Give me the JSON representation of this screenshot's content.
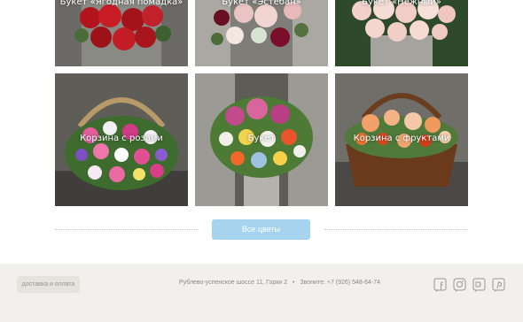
{
  "gallery": {
    "items": [
      {
        "caption": "Букет «Ягодная помадка»",
        "icon": "bouquet-photo"
      },
      {
        "caption": "Букет «Эстебан»",
        "icon": "bouquet-photo"
      },
      {
        "caption": "Букет «Нежный»",
        "icon": "bouquet-photo"
      },
      {
        "caption": "Корзина с розами",
        "icon": "basket-photo"
      },
      {
        "caption": "Букет",
        "icon": "bouquet-photo"
      },
      {
        "caption": "Корзина с фруктами",
        "icon": "basket-photo"
      }
    ],
    "all_button_label": "Все цветы"
  },
  "footer": {
    "delivery_label": "доставка и оплата",
    "address": "Рублево-успенское шоссе 11, Горки 2",
    "phone_label": "Звоните: +7 (926) 548-64-74",
    "separator": "•",
    "socials": [
      "facebook-icon",
      "instagram-icon",
      "vk-icon",
      "pinterest-icon"
    ]
  },
  "colors": {
    "button_blue": "#a6d3ee",
    "footer_bg": "#f2f0ed",
    "footer_text": "#8e8983"
  }
}
